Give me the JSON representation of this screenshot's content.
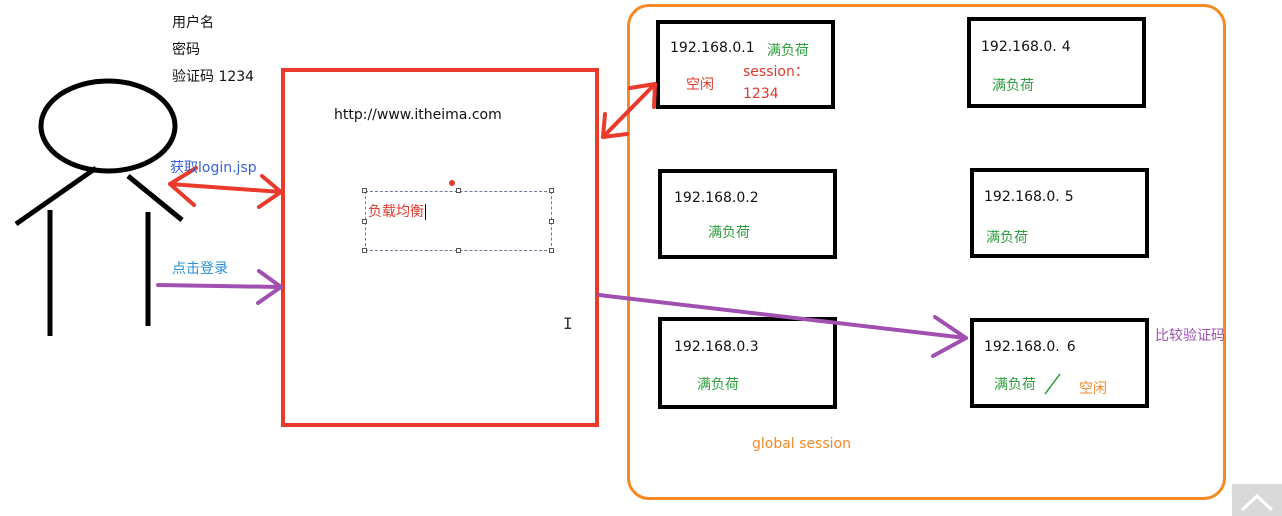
{
  "client": {
    "username_label": "用户名",
    "password_label": "密码",
    "captcha_label": "验证码  1234"
  },
  "arrows": {
    "get_login": "获取login.jsp",
    "click_login": "点击登录",
    "compare_captcha": "比较验证码"
  },
  "load_balancer": {
    "url": "http://www.itheima.com",
    "selected_text": "负载均衡"
  },
  "cluster": {
    "label": "global session",
    "servers": [
      {
        "ip": "192.168.0.1",
        "status": "满负荷",
        "idle": "空闲",
        "session_line1": "session：",
        "session_line2": "1234"
      },
      {
        "ip": "192.168.0.2",
        "status": "满负荷"
      },
      {
        "ip": "192.168.0.3",
        "status": "满负荷"
      },
      {
        "ip": "192.168.0.",
        "ip_suffix": "4",
        "status": "满负荷"
      },
      {
        "ip": "192.168.0.",
        "ip_suffix": "5",
        "status": "满负荷"
      },
      {
        "ip": "192.168.0.",
        "ip_suffix": "6",
        "status": "满负荷",
        "idle": "空闲"
      }
    ]
  },
  "colors": {
    "red": "#ea3a2b",
    "orange": "#f58a24",
    "green": "#2e9e3e",
    "purple": "#a050b0",
    "black": "#000000"
  }
}
